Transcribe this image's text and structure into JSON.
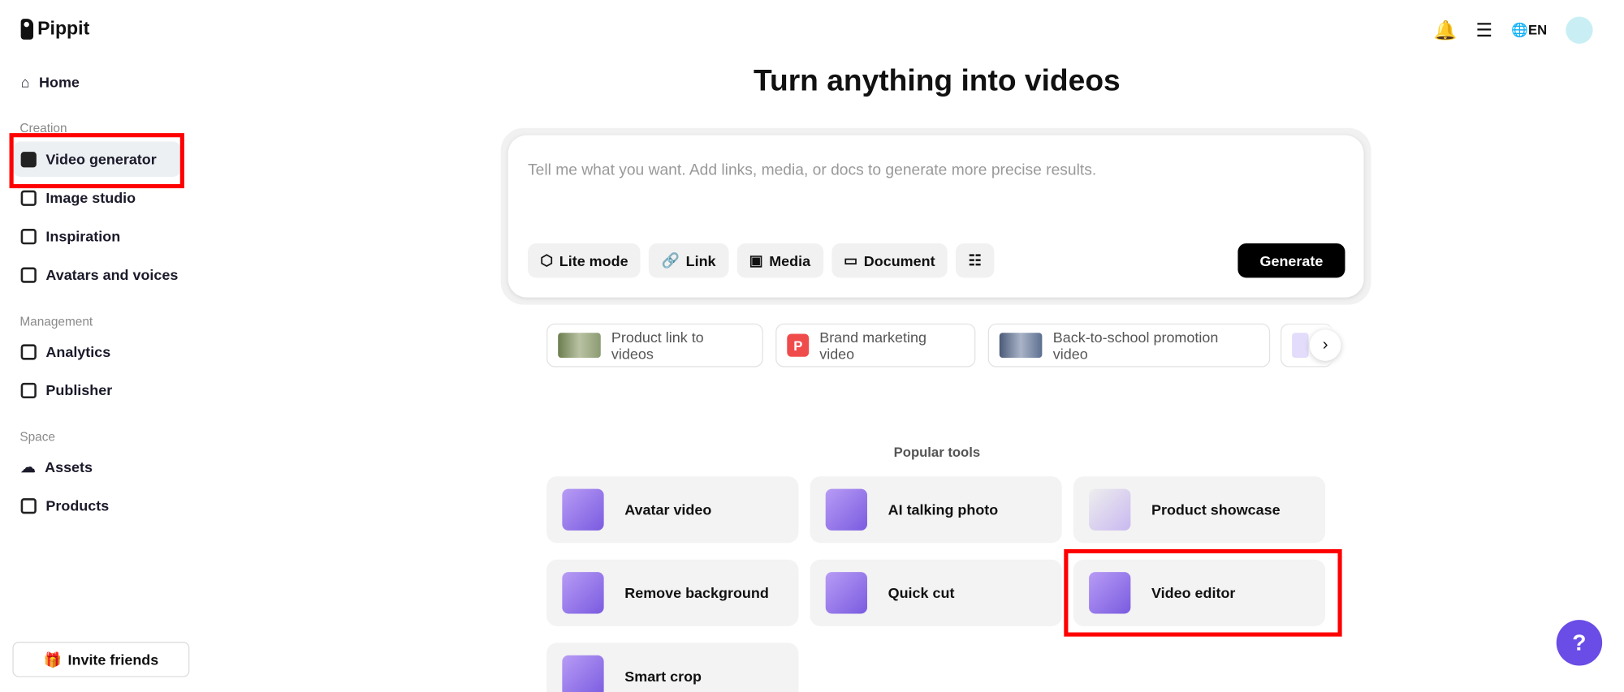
{
  "app": {
    "name": "Pippit"
  },
  "sidebar": {
    "home": "Home",
    "sections": [
      "Creation",
      "Management",
      "Space"
    ],
    "creation": [
      "Video generator",
      "Image studio",
      "Inspiration",
      "Avatars and voices"
    ],
    "management": [
      "Analytics",
      "Publisher"
    ],
    "space": [
      "Assets",
      "Products"
    ],
    "invite": "Invite friends"
  },
  "header": {
    "language": "EN"
  },
  "main": {
    "title": "Turn anything into videos",
    "placeholder": "Tell me what you want. Add links, media, or docs to generate more precise results.",
    "chips": [
      "Lite mode",
      "Link",
      "Media",
      "Document"
    ],
    "generate": "Generate",
    "suggestions": [
      "Product link to videos",
      "Brand marketing video",
      "Back-to-school promotion video"
    ],
    "brand_badge": "P",
    "popular_title": "Popular tools",
    "tools": [
      "Avatar video",
      "AI talking photo",
      "Product showcase",
      "Remove background",
      "Quick cut",
      "Video editor",
      "Smart crop"
    ]
  },
  "help": "?"
}
